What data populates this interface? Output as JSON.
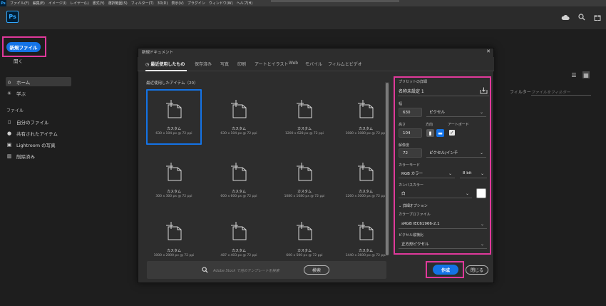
{
  "menubar": {
    "logo": "Ps",
    "items": [
      "ファイル(F)",
      "編集(E)",
      "イメージ(I)",
      "レイヤー(L)",
      "書式(Y)",
      "選択範囲(S)",
      "フィルター(T)",
      "3D(D)",
      "表示(V)",
      "プラグイン",
      "ウィンドウ(W)",
      "ヘルプ(H)"
    ]
  },
  "appbar": {
    "logo": "Ps",
    "icons": [
      "cloud-icon",
      "search-icon",
      "gift-icon"
    ]
  },
  "left_nav": {
    "new_file": "新規ファイル",
    "open": "開く",
    "items": [
      {
        "label": "ホーム",
        "icon": "home-icon",
        "active": true
      },
      {
        "label": "学ぶ",
        "icon": "lightbulb-icon",
        "active": false
      }
    ],
    "files_section": "ファイル",
    "file_items": [
      {
        "label": "自分のファイル",
        "icon": "document-icon"
      },
      {
        "label": "共有されたアイテム",
        "icon": "shared-user-icon"
      },
      {
        "label": "Lightroom の写真",
        "icon": "lightroom-icon"
      },
      {
        "label": "削除済み",
        "icon": "trash-icon"
      }
    ]
  },
  "background": {
    "filter_label": "フィルター",
    "filter_placeholder": "ファイルをフィルター"
  },
  "dialog": {
    "title": "新規ドキュメント",
    "tabs": [
      "最近使用したもの",
      "保存済み",
      "写真",
      "印刷",
      "アートとイラスト",
      "Web",
      "モバイル",
      "フィルムとビデオ"
    ],
    "recent_label": "最近使用したアイテム（20）",
    "cards": [
      {
        "title": "カスタム",
        "size": "630 x 104 px @ 72 ppi"
      },
      {
        "title": "カスタム",
        "size": "630 x 104 px @ 72 ppi"
      },
      {
        "title": "カスタム",
        "size": "1200 x 628 px @ 72 ppi"
      },
      {
        "title": "カスタム",
        "size": "1080 x 1080 px @ 72 ppi"
      },
      {
        "title": "カスタム",
        "size": "300 x 300 px @ 72 ppi"
      },
      {
        "title": "カスタム",
        "size": "600 x 600 px @ 72 ppi"
      },
      {
        "title": "カスタム",
        "size": "1080 x 1080 px @ 72 ppi"
      },
      {
        "title": "カスタム",
        "size": "1260 x 3000 px @ 72 ppi"
      },
      {
        "title": "カスタム",
        "size": "1000 x 2000 px @ 72 ppi"
      },
      {
        "title": "カスタム",
        "size": "487 x 403 px @ 72 ppi"
      },
      {
        "title": "カスタム",
        "size": "600 x 500 px @ 72 ppi"
      },
      {
        "title": "カスタム",
        "size": "1440 x 3600 px @ 72 ppi"
      }
    ],
    "search_placeholder": "Adobe Stock で他のテンプレートを検索",
    "search_button": "検索"
  },
  "details": {
    "header": "プリセットの詳細",
    "name": "名称未設定 1",
    "width_label": "幅",
    "width_value": "630",
    "width_unit": "ピクセル",
    "height_label": "高さ",
    "height_value": "104",
    "orientation_label": "方向",
    "artboard_label": "アートボード",
    "resolution_label": "解像度",
    "resolution_value": "72",
    "resolution_unit": "ピクセル/インチ",
    "color_mode_label": "カラーモード",
    "color_mode_value": "RGB カラー",
    "bit_depth": "8 bit",
    "canvas_label": "カンバスカラー",
    "canvas_value": "白",
    "advanced_label": "詳細オプション",
    "profile_label": "カラープロファイル",
    "profile_value": "sRGB IEC61966-2.1",
    "aspect_label": "ピクセル縦横比",
    "aspect_value": "正方形ピクセル"
  },
  "actions": {
    "create": "作成",
    "close": "閉じる"
  },
  "colors": {
    "accent": "#1473e6",
    "highlight": "#e0399b"
  }
}
